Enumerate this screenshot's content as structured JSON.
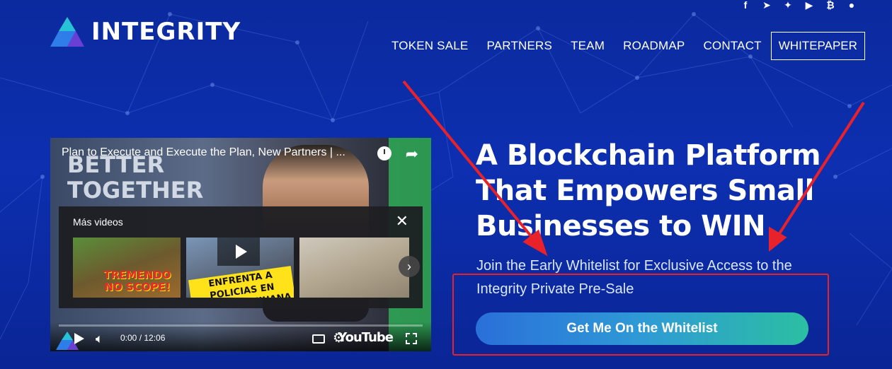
{
  "brand": {
    "name": "INTEGRITY",
    "accent_colors": [
      "#27c2d6",
      "#2f7de8",
      "#6a3fd6"
    ]
  },
  "social": [
    {
      "name": "facebook-icon",
      "glyph": "f"
    },
    {
      "name": "telegram-icon",
      "glyph": "➤"
    },
    {
      "name": "twitter-icon",
      "glyph": "✦"
    },
    {
      "name": "youtube-icon",
      "glyph": "▶"
    },
    {
      "name": "bitcoin-icon",
      "glyph": "₿"
    },
    {
      "name": "reddit-icon",
      "glyph": "●"
    }
  ],
  "nav": {
    "items": [
      "TOKEN SALE",
      "PARTNERS",
      "TEAM",
      "ROADMAP",
      "CONTACT"
    ],
    "whitepaper": "WHITEPAPER"
  },
  "video": {
    "title": "Plan to Execute and Execute the Plan, New Partners | ...",
    "overlay_text": "BETTER TOGETHER",
    "more_videos_label": "Más videos",
    "thumbnails": [
      {
        "caption": "TREMENDO NO SCOPE!"
      },
      {
        "caption": "ENFRENTA A POLICIAS EN RETEN DE TIJUANA"
      },
      {
        "caption": ""
      }
    ],
    "time": "0:00 / 12:06",
    "youtube_label": "YouTube"
  },
  "hero": {
    "title": "A Blockchain Platform That Empowers Small Businesses to WIN",
    "subtitle": "Join the Early Whitelist for Exclusive Access to the Integrity Private Pre-Sale",
    "cta": "Get Me On the Whitelist"
  },
  "colors": {
    "background": "#0d2fb0",
    "annotation": "#e8222b",
    "cta_start": "#2a6fd9",
    "cta_end": "#2bbfa2"
  }
}
